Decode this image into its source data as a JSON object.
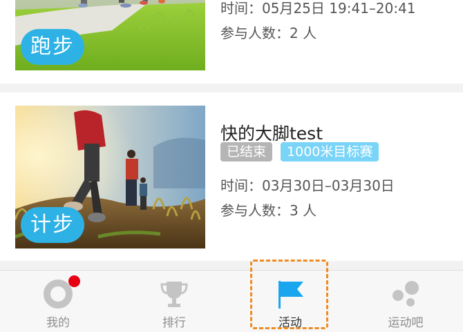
{
  "activities": [
    {
      "title": "",
      "type_badge": "跑步",
      "time": "时间：05月25日 19:41–20:41",
      "participants": "参与人数：2 人"
    },
    {
      "title": "快的大脚test",
      "status_tag": "已结束",
      "goal_tag": "1000米目标赛",
      "type_badge": "计步",
      "time": "时间：03月30日–03月30日",
      "participants": "参与人数：3 人"
    }
  ],
  "tabbar": {
    "tabs": [
      {
        "label": "我的",
        "icon": "profile-ring-icon"
      },
      {
        "label": "排行",
        "icon": "trophy-icon"
      },
      {
        "label": "活动",
        "icon": "flag-icon"
      },
      {
        "label": "运动吧",
        "icon": "bubbles-icon"
      }
    ],
    "active_index": 2,
    "notification_badge_tab": 0
  },
  "colors": {
    "badge_blue": "#2eb2e6",
    "tag_grey": "#b5b5b5",
    "tag_light_blue": "#7ad4f7",
    "active_icon_blue": "#19a6ee",
    "inactive_grey": "#c4c4c4",
    "notification_red": "#e60012",
    "highlight_orange": "#f08a1e"
  }
}
